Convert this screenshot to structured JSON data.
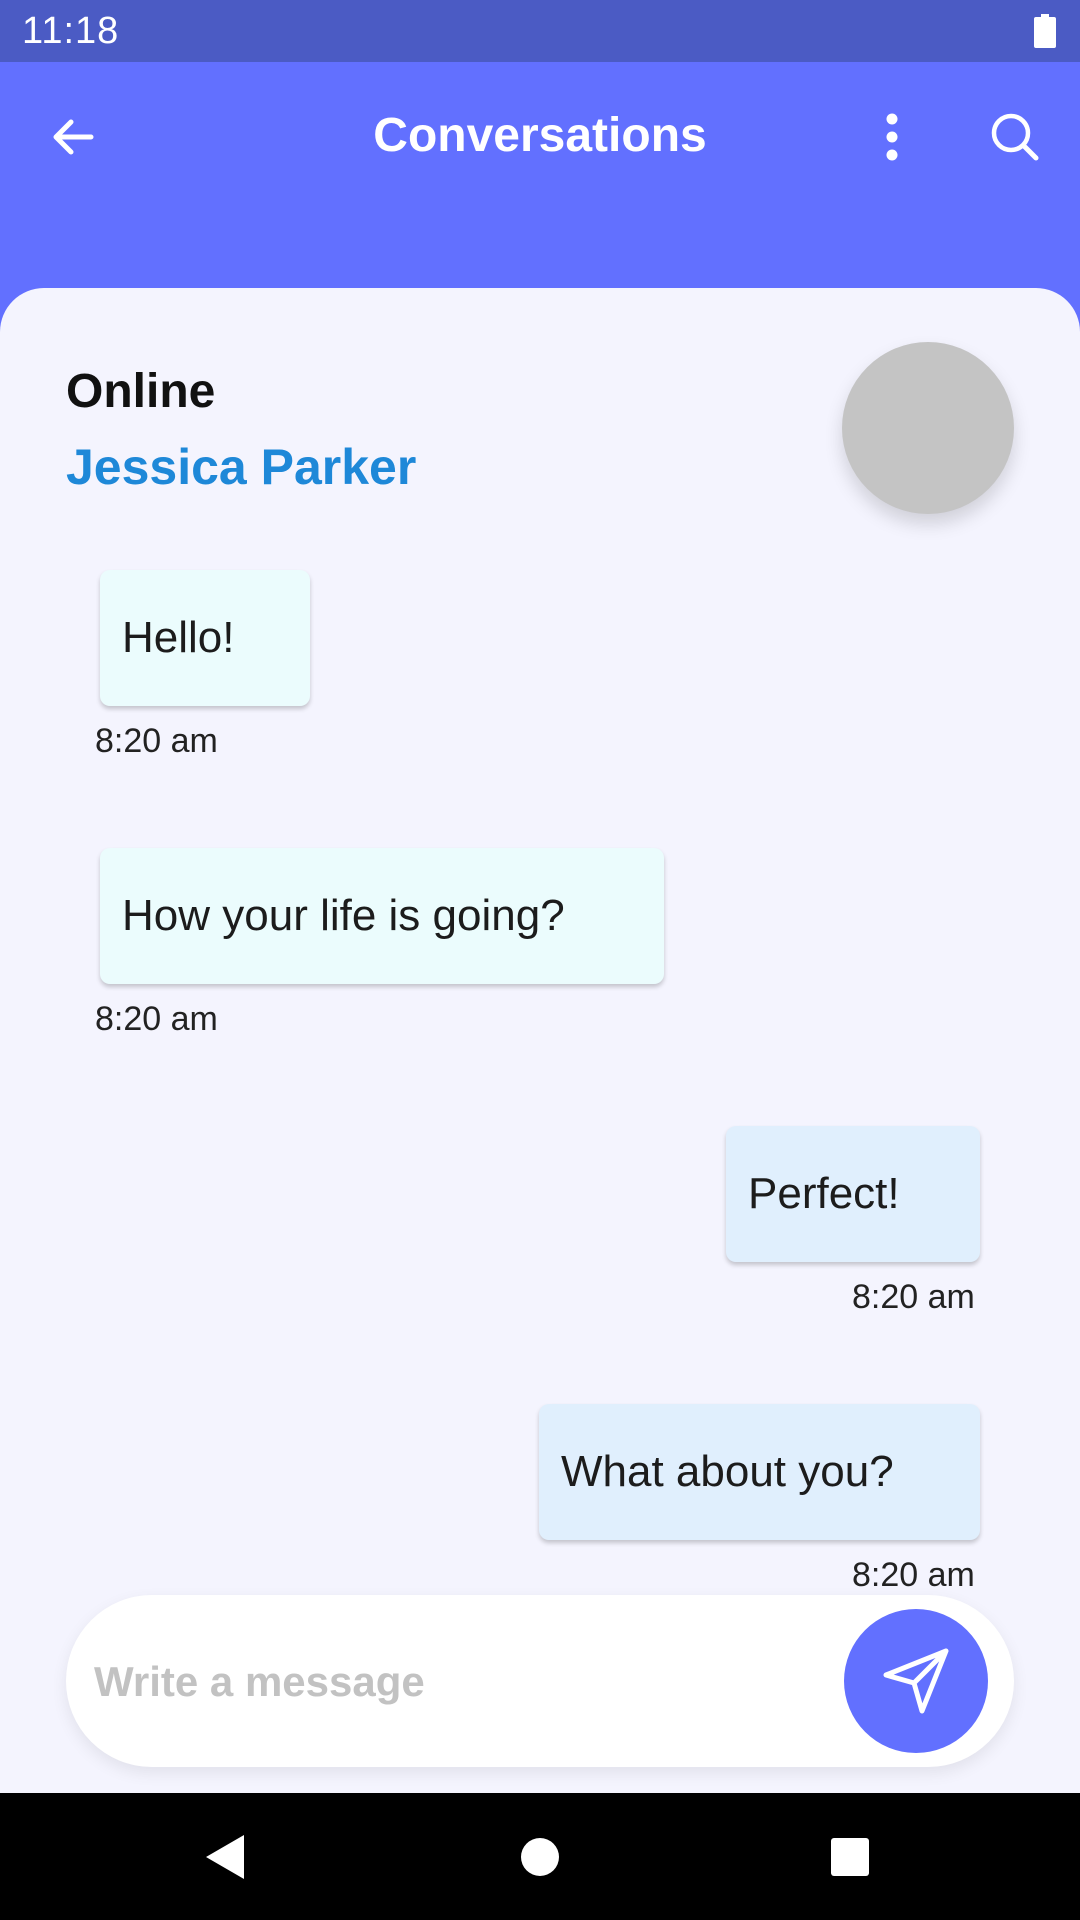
{
  "status_bar": {
    "time": "11:18"
  },
  "app_bar": {
    "title": "Conversations"
  },
  "contact": {
    "status": "Online",
    "name": "Jessica Parker"
  },
  "messages": [
    {
      "direction": "incoming",
      "text": "Hello!",
      "time": "8:20 am"
    },
    {
      "direction": "incoming",
      "text": "How your life is going?",
      "time": "8:20 am"
    },
    {
      "direction": "outgoing",
      "text": "Perfect!",
      "time": "8:20 am"
    },
    {
      "direction": "outgoing",
      "text": "What about you?",
      "time": "8:20 am"
    }
  ],
  "compose": {
    "placeholder": "Write a message",
    "value": ""
  },
  "icons": {
    "back": "arrow-back-icon",
    "more": "more-vertical-icon",
    "search": "search-icon",
    "send": "send-icon",
    "battery": "battery-icon",
    "nav_back": "nav-back-icon",
    "nav_home": "nav-home-icon",
    "nav_recents": "nav-recents-icon"
  },
  "colors": {
    "primary": "#6270FF",
    "status_bar": "#4B5BC4",
    "background": "#F4F4FE",
    "contact_name": "#1E88D8",
    "incoming_bubble": "#EBFCFD",
    "outgoing_bubble": "#E0EFFD",
    "avatar_placeholder": "#C4C4C4"
  }
}
